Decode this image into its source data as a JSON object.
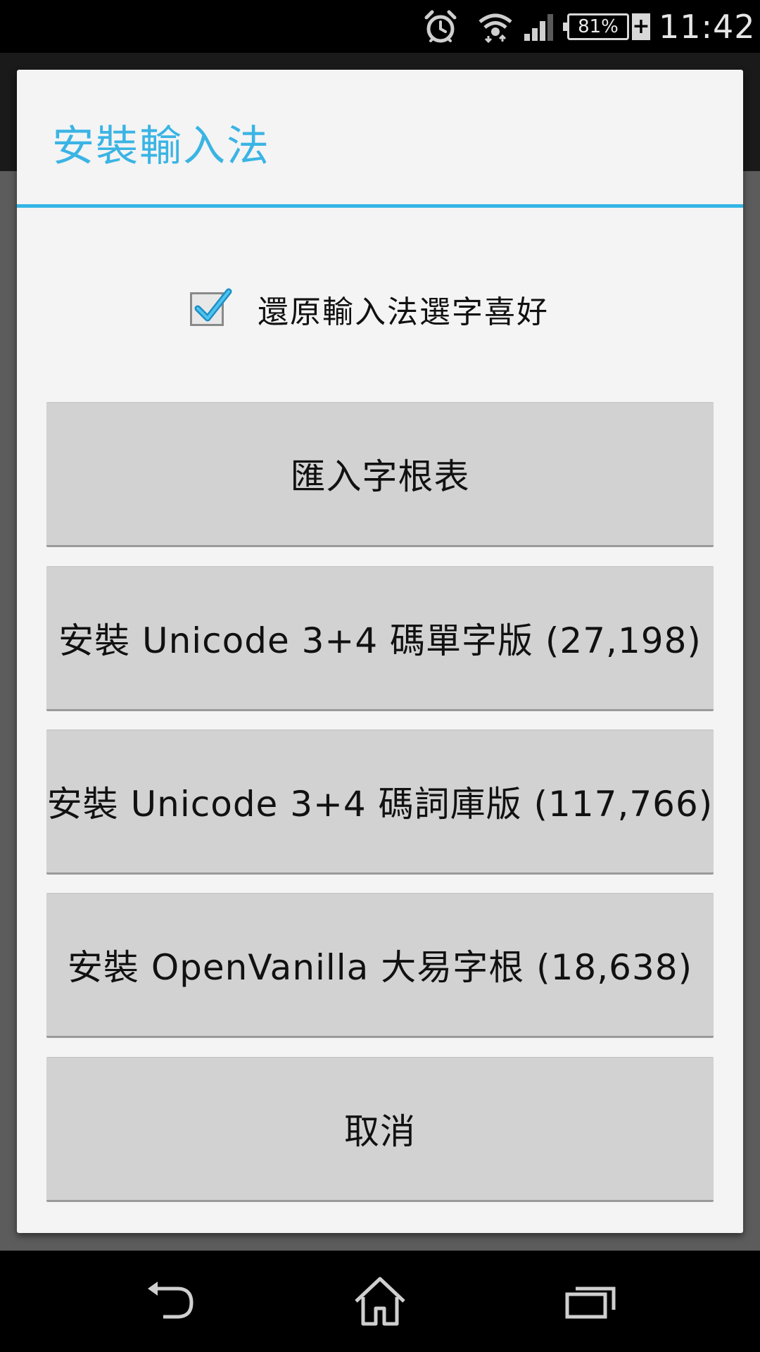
{
  "status_bar": {
    "battery_percent": "81%",
    "battery_charging_symbol": "+",
    "time": "11:42",
    "icons": [
      "alarm-icon",
      "wifi-icon",
      "cell-signal-icon",
      "battery-icon"
    ]
  },
  "dialog": {
    "title": "安裝輸入法",
    "checkbox": {
      "label": "還原輸入法選字喜好",
      "checked": true
    },
    "buttons": [
      {
        "label": "匯入字根表"
      },
      {
        "label": "安裝 Unicode 3+4 碼單字版 (27,198)"
      },
      {
        "label": "安裝 Unicode 3+4 碼詞庫版 (117,766)"
      },
      {
        "label": "安裝 OpenVanilla 大易字根 (18,638)"
      },
      {
        "label": "取消"
      }
    ]
  },
  "nav_bar": {
    "icons": [
      "back-icon",
      "home-icon",
      "recent-apps-icon"
    ]
  },
  "colors": {
    "accent": "#33b5e5",
    "dialog_background": "#f4f4f4",
    "button_background": "#d2d2d2"
  }
}
